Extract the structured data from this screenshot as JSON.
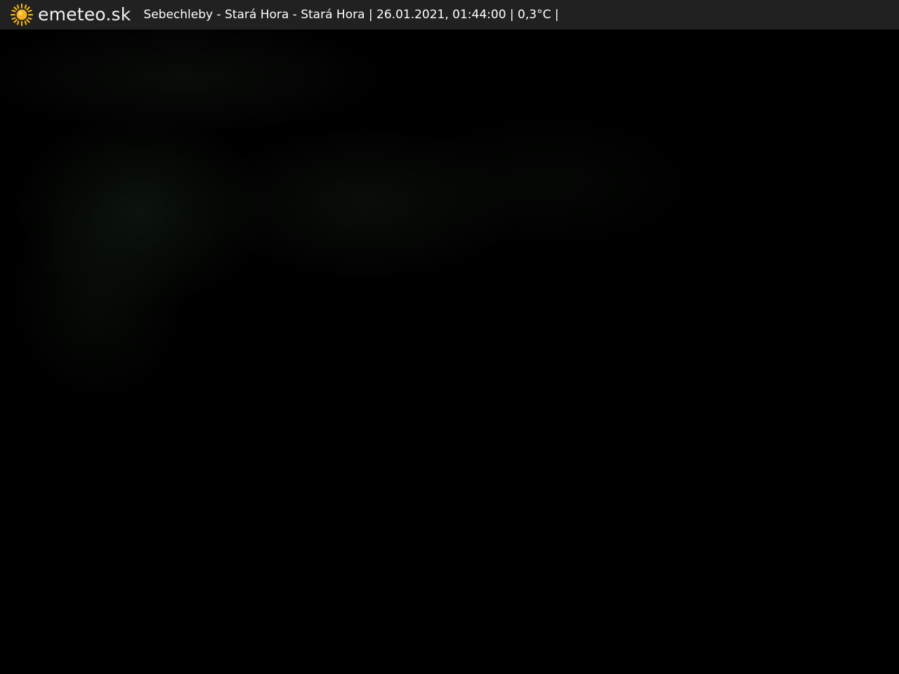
{
  "overlay": {
    "brand": "emeteo.sk",
    "caption": "Sebechleby - Stará Hora - Stará Hora | 26.01.2021, 01:44:00 | 0,3°C |",
    "logo_icon": "sun-icon",
    "bar_color": "#212121",
    "sun_color": "#f5b21b"
  },
  "image": {
    "subject": "night-time webcam view"
  }
}
